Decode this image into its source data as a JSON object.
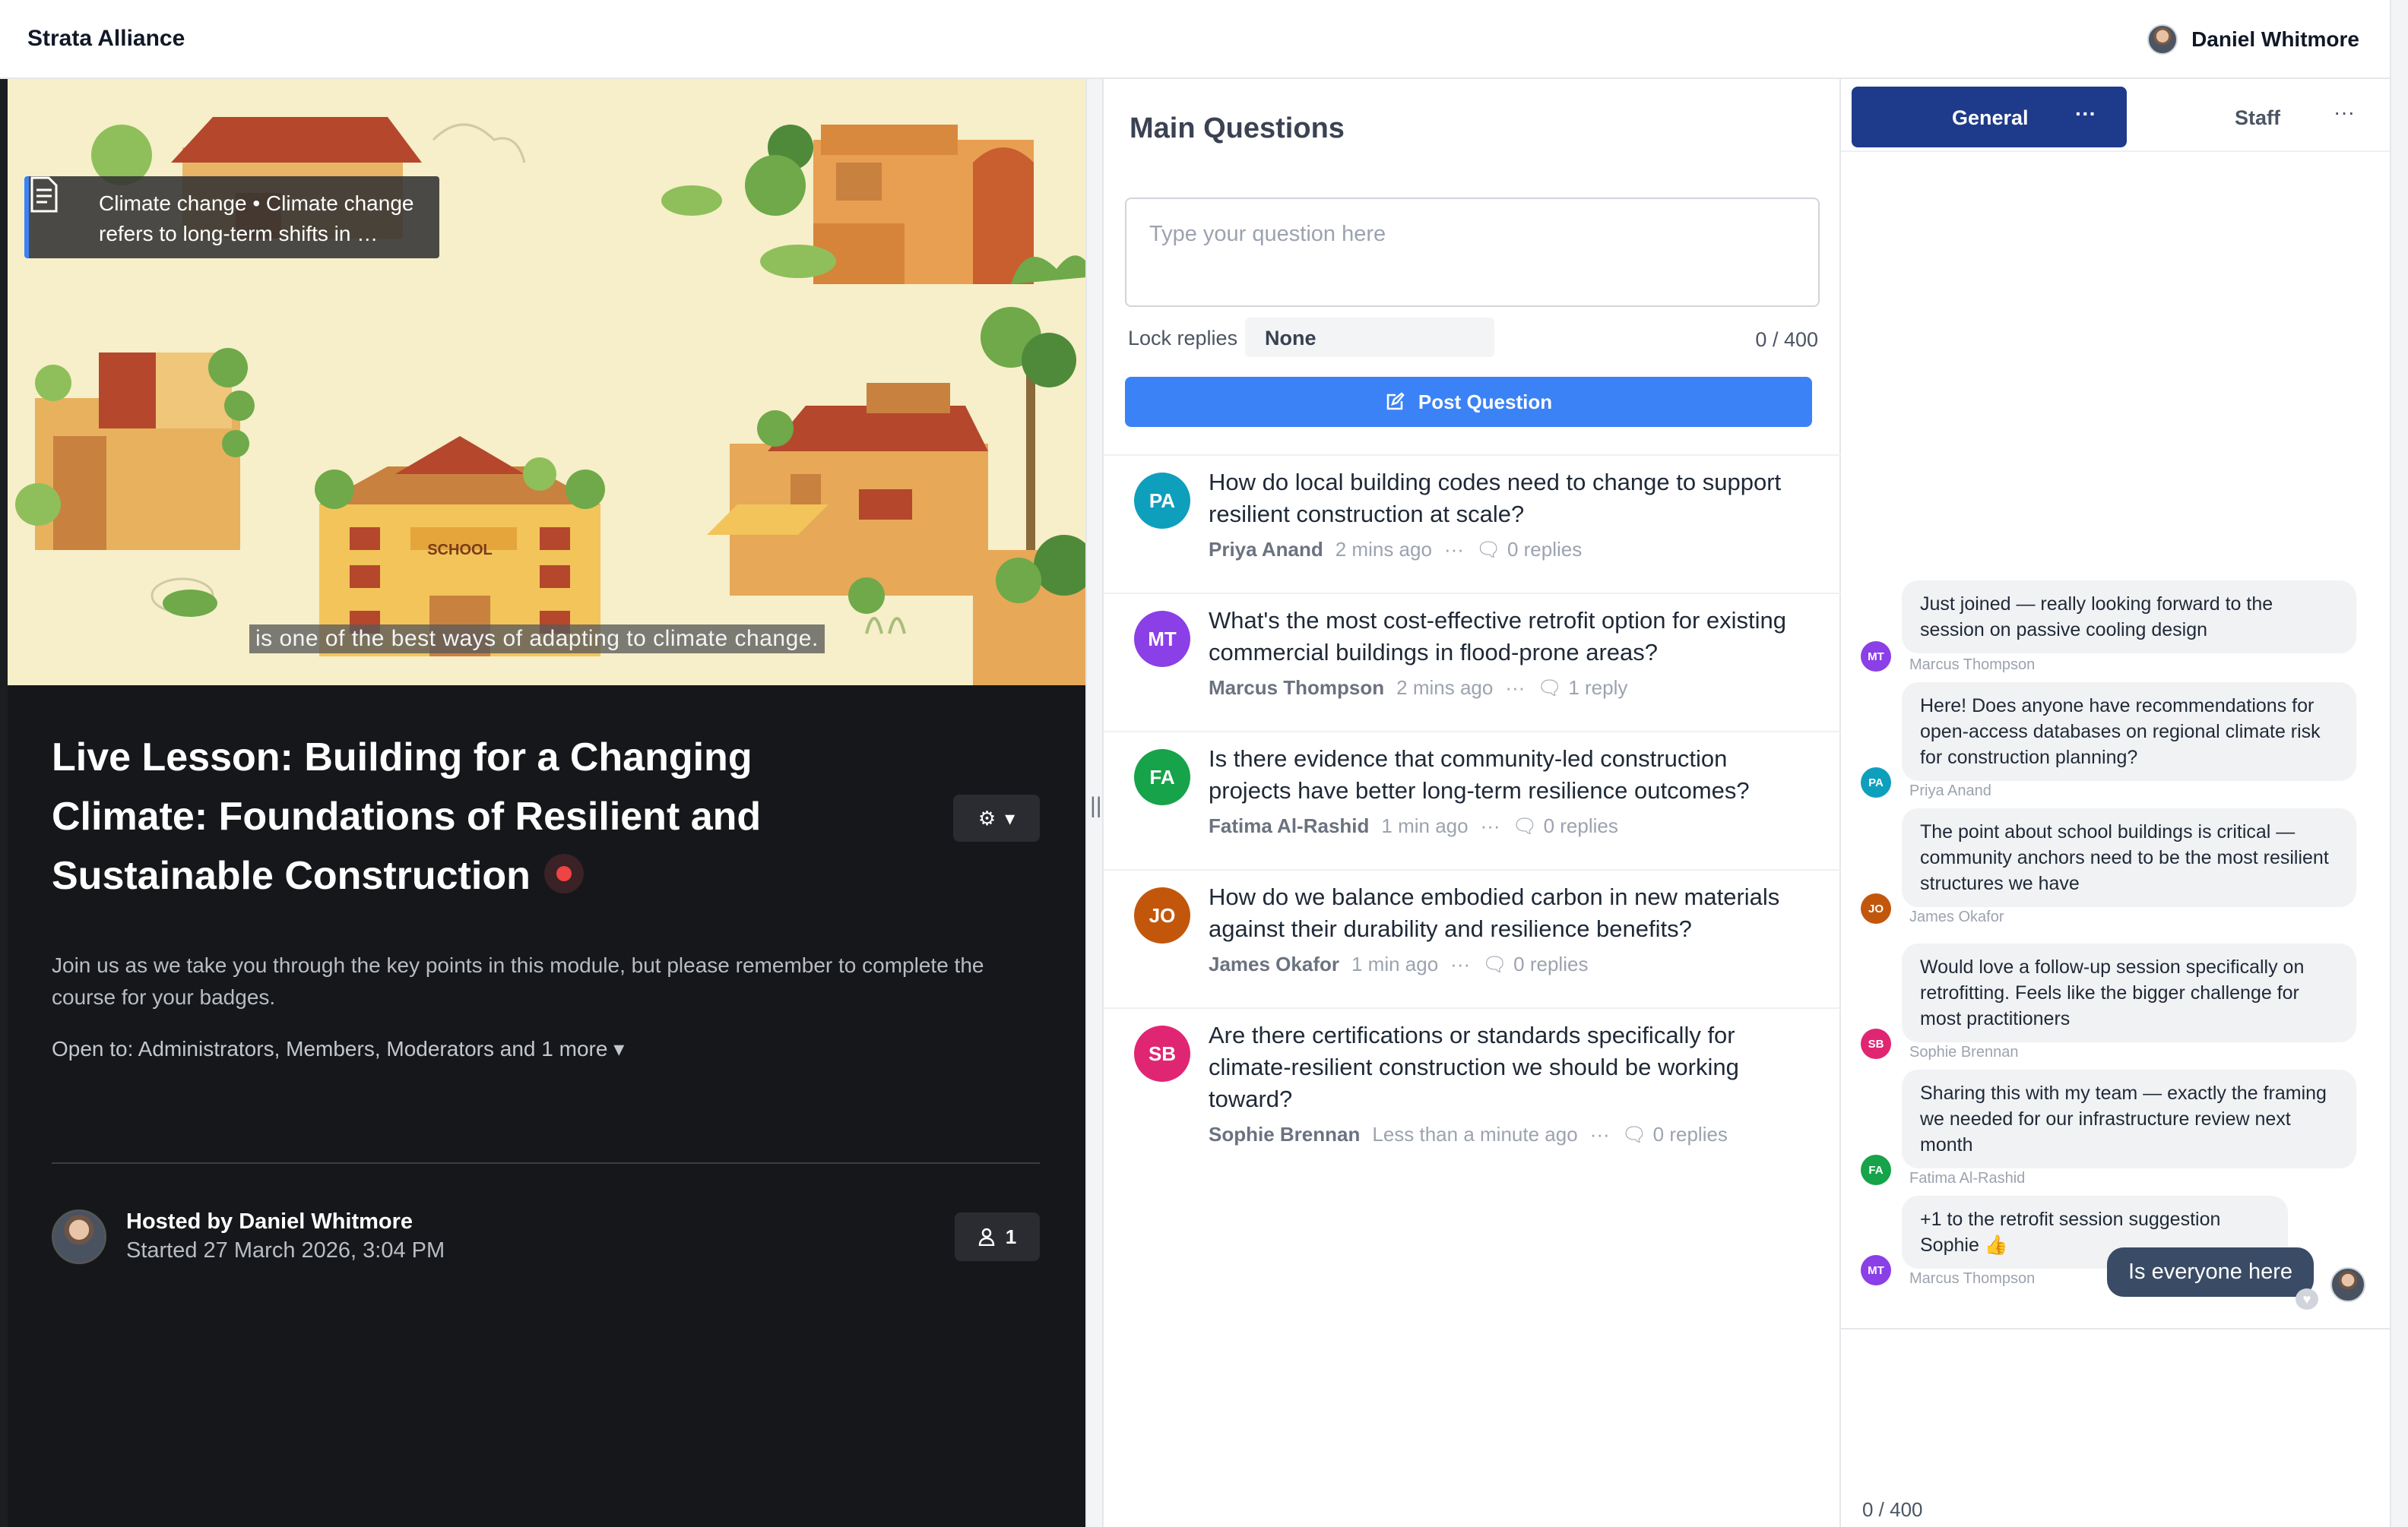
{
  "app": {
    "brand": "Strata Alliance",
    "user_name": "Daniel Whitmore"
  },
  "video": {
    "caption_card": "Climate change • Climate change refers to long-term shifts in …",
    "subtitle": "is one of the best ways of adapting to climate change.",
    "school_sign": "SCHOOL"
  },
  "lesson": {
    "title": "Live Lesson: Building for a Changing Climate: Foundations of Resilient and Sustainable Construction",
    "description": "Join us as we take you through the key points in this module, but please remember to complete the course for your badges.",
    "open_to": "Open to: Administrators, Members, Moderators and 1 more",
    "host": "Hosted by Daniel Whitmore",
    "started": "Started 27 March 2026, 3:04 PM",
    "attendees": "1"
  },
  "questions": {
    "heading": "Main Questions",
    "placeholder": "Type your question here",
    "lock_label": "Lock replies",
    "lock_value": "None",
    "counter": "0 / 400",
    "post_label": "Post Question",
    "items": [
      {
        "initials": "PA",
        "color": "#0e9fbd",
        "text": "How do local building codes need to change to support resilient construction at scale?",
        "author": "Priya Anand",
        "time": "2 mins ago",
        "replies": "0 replies"
      },
      {
        "initials": "MT",
        "color": "#8b3fe6",
        "text": "What's the most cost-effective retrofit option for existing commercial buildings in flood-prone areas?",
        "author": "Marcus Thompson",
        "time": "2 mins ago",
        "replies": "1 reply"
      },
      {
        "initials": "FA",
        "color": "#16a34a",
        "text": "Is there evidence that community-led construction projects have better long-term resilience outcomes?",
        "author": "Fatima Al-Rashid",
        "time": "1 min ago",
        "replies": "0 replies"
      },
      {
        "initials": "JO",
        "color": "#c2570c",
        "text": "How do we balance embodied carbon in new materials against their durability and resilience benefits?",
        "author": "James Okafor",
        "time": "1 min ago",
        "replies": "0 replies"
      },
      {
        "initials": "SB",
        "color": "#e02673",
        "text": "Are there certifications or standards specifically for climate-resilient construction we should be working toward?",
        "author": "Sophie Brennan",
        "time": "Less than a minute ago",
        "replies": "0 replies"
      }
    ]
  },
  "chat": {
    "tab_general": "General",
    "tab_staff": "Staff",
    "messages": [
      {
        "initials": "MT",
        "color": "#8b3fe6",
        "text": "Just joined — really looking forward to the session on passive cooling design",
        "name": "Marcus Thompson"
      },
      {
        "initials": "PA",
        "color": "#0e9fbd",
        "text": "Here! Does anyone have recommendations for open-access databases on regional climate risk for construction planning?",
        "name": "Priya Anand"
      },
      {
        "initials": "JO",
        "color": "#c2570c",
        "text": "The point about school buildings is critical — community anchors need to be the most resilient structures we have",
        "name": "James Okafor"
      },
      {
        "initials": "SB",
        "color": "#e02673",
        "text": "Would love a follow-up session specifically on retrofitting. Feels like the bigger challenge for most practitioners",
        "name": "Sophie Brennan"
      },
      {
        "initials": "FA",
        "color": "#16a34a",
        "text": "Sharing this with my team — exactly the framing we needed for our infrastructure review next month",
        "name": "Fatima Al-Rashid"
      },
      {
        "initials": "MT",
        "color": "#8b3fe6",
        "text": "+1 to the retrofit session suggestion Sophie 👍",
        "name": "Marcus Thompson"
      }
    ],
    "own_message": "Is everyone here",
    "counter": "0 / 400"
  }
}
